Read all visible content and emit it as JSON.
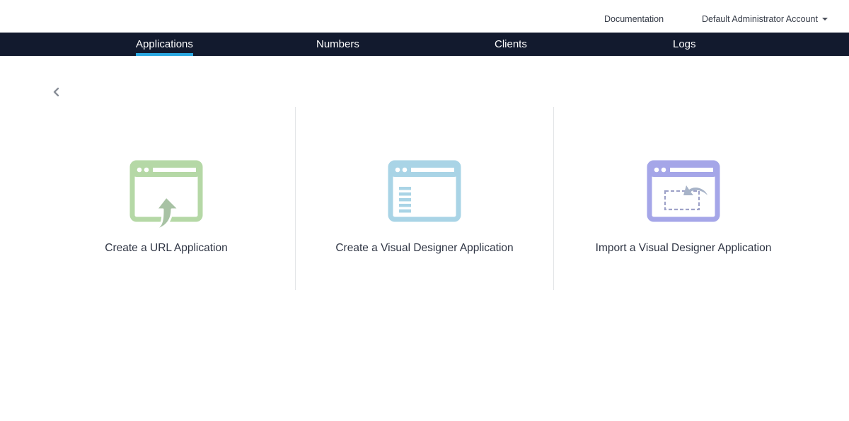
{
  "header": {
    "documentation_label": "Documentation",
    "account_label": "Default Administrator Account"
  },
  "nav": {
    "tabs": [
      {
        "label": "Applications",
        "active": true
      },
      {
        "label": "Numbers",
        "active": false
      },
      {
        "label": "Clients",
        "active": false
      },
      {
        "label": "Logs",
        "active": false
      }
    ]
  },
  "back": {
    "icon": "chevron-left-icon"
  },
  "options": [
    {
      "label": "Create a URL Application",
      "icon": "url-upload-icon",
      "color": "#b5d8a6"
    },
    {
      "label": "Create a Visual Designer Application",
      "icon": "visual-designer-icon",
      "color": "#a9d4e6"
    },
    {
      "label": "Import a Visual Designer Application",
      "icon": "import-icon",
      "color": "#a5a6e8"
    }
  ],
  "colors": {
    "navbar": "#121a2e",
    "active_tab_indicator": "#2aa7e0",
    "arrow_accent": "#a8c2a4"
  }
}
